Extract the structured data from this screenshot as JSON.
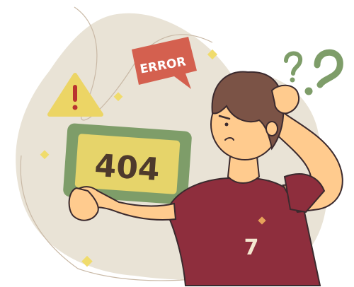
{
  "illustration": {
    "bubble_text": "ERROR",
    "screen_text": "404",
    "question_marks": [
      "?",
      "?"
    ],
    "shirt_logo": "7"
  },
  "colors": {
    "blob": "#e9e3d6",
    "error_bubble": "#d4604f",
    "warning": "#ecd565",
    "screen_frame": "#7e9d69",
    "screen_face": "#e6d46a",
    "outline": "#3b2a2e",
    "skin": "#ffcb8e",
    "hair": "#7b5346",
    "shirt": "#8e2e3d",
    "question": "#7e9d69",
    "diamond": "#f0dc6c"
  }
}
